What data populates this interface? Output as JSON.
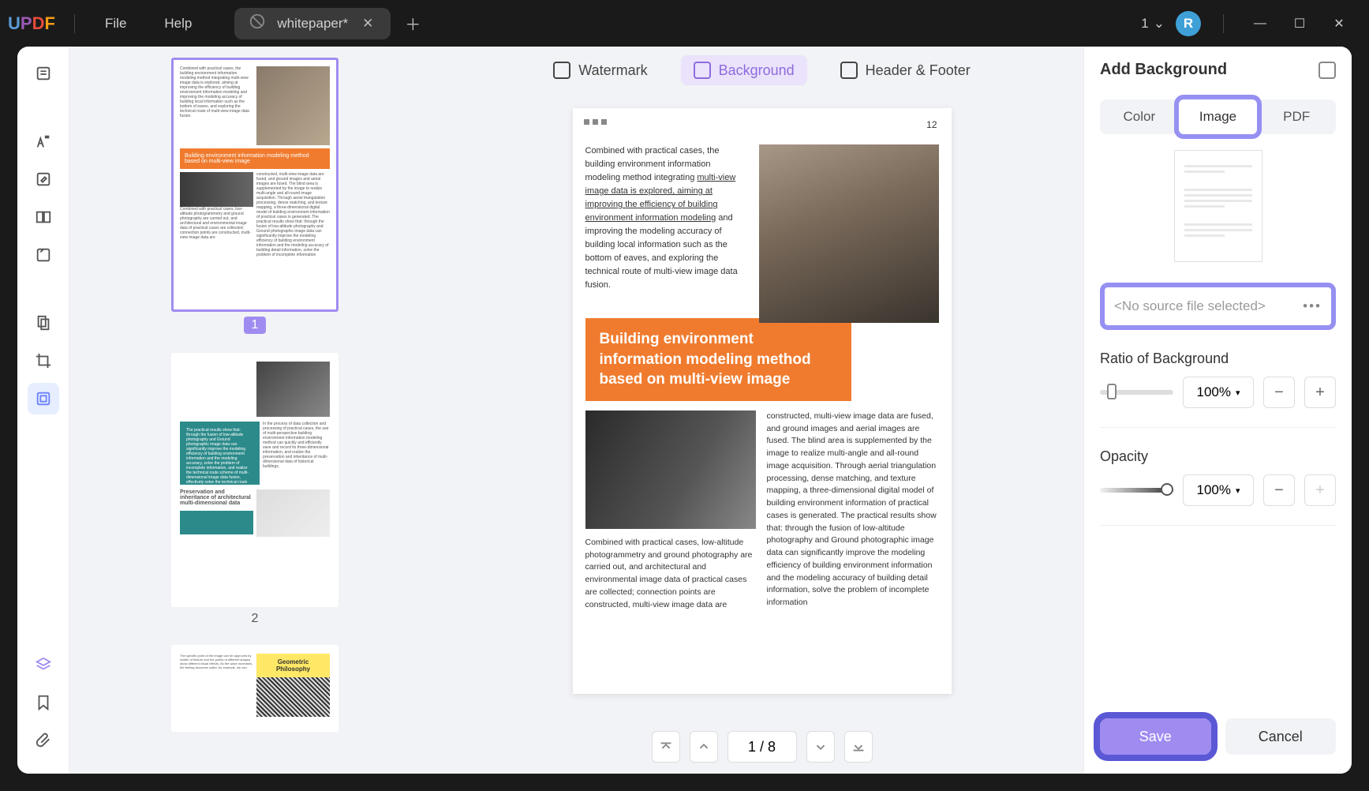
{
  "titlebar": {
    "menu_file": "File",
    "menu_help": "Help",
    "tab_title": "whitepaper*",
    "tab_count": "1",
    "avatar": "R"
  },
  "center_tabs": {
    "watermark": "Watermark",
    "background": "Background",
    "header_footer": "Header & Footer"
  },
  "page": {
    "number": "12",
    "para1a": "Combined with practical cases, the building environment information modeling method integrating ",
    "para1b": "multi-view image data is explored, aiming at improving the efficiency of building environment information modeling",
    "para1c": " and improving the modeling accuracy of building local information such as the bottom of eaves, and exploring the technical route of multi-view image data fusion.",
    "title_block": "Building environment information modeling method based on multi-view image",
    "para2": "constructed, multi-view image data are fused, and ground images and aerial images are fused. The blind area is supplemented by the image to realize multi-angle and all-round image acquisition. Through aerial triangulation processing, dense matching, and texture mapping, a three-dimensional digital model of building environment information of practical cases is generated. The practical results show that: through the fusion of low-altitude photography and Ground photographic image data can significantly improve the modeling efficiency of building environment information and the modeling accuracy of building detail information, solve the problem of incomplete information",
    "para3": "Combined with practical cases, low-altitude photogrammetry and ground photography are carried out, and architectural and environmental image data of practical cases are collected; connection points are constructed, multi-view image data are"
  },
  "pagination": {
    "current": "1",
    "total": "8"
  },
  "thumbs": {
    "p1": "1",
    "p2": "2",
    "t1_title": "Building environment information modeling method based on multi-view image",
    "t2_title": "Preservation and inheritance of architectural multi-dimensional data",
    "t3_title": "Geometric Philosophy"
  },
  "rpanel": {
    "title": "Add Background",
    "tab_color": "Color",
    "tab_image": "Image",
    "tab_pdf": "PDF",
    "no_file": "<No source file selected>",
    "ratio_label": "Ratio of Background",
    "ratio_value": "100%",
    "opacity_label": "Opacity",
    "opacity_value": "100%",
    "save": "Save",
    "cancel": "Cancel"
  }
}
